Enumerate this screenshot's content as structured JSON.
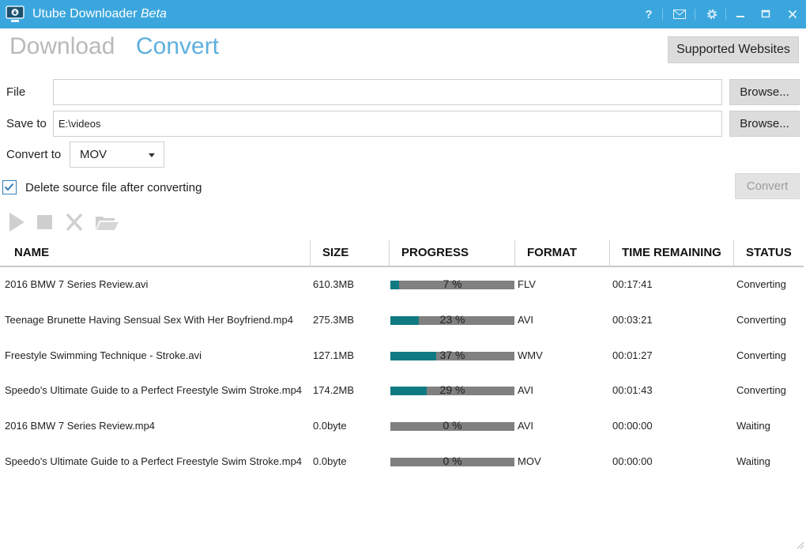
{
  "app": {
    "title": "Utube Downloader",
    "beta": "Beta"
  },
  "tabs": {
    "download": "Download",
    "convert": "Convert"
  },
  "header": {
    "supported_websites": "Supported Websites"
  },
  "form": {
    "file_label": "File",
    "file_value": "",
    "save_to_label": "Save to",
    "save_to_value": "E:\\videos",
    "browse_label": "Browse...",
    "convert_to_label": "Convert to",
    "convert_to_value": "MOV",
    "delete_source_label": "Delete source file after converting",
    "delete_source_checked": true,
    "convert_button": "Convert"
  },
  "toolbar": {
    "icons": [
      "play-icon",
      "stop-icon",
      "delete-icon",
      "open-folder-icon"
    ]
  },
  "table": {
    "headers": [
      "NAME",
      "SIZE",
      "PROGRESS",
      "FORMAT",
      "TIME REMAINING",
      "STATUS"
    ],
    "rows": [
      {
        "name": "2016 BMW 7 Series Review.avi",
        "size": "610.3MB",
        "progress": 7,
        "progress_text": "7 %",
        "format": "FLV",
        "time": "00:17:41",
        "status": "Converting"
      },
      {
        "name": "Teenage Brunette Having Sensual Sex With Her Boyfriend.mp4",
        "size": "275.3MB",
        "progress": 23,
        "progress_text": "23 %",
        "format": "AVI",
        "time": "00:03:21",
        "status": "Converting"
      },
      {
        "name": "Freestyle Swimming Technique - Stroke.avi",
        "size": "127.1MB",
        "progress": 37,
        "progress_text": "37 %",
        "format": "WMV",
        "time": "00:01:27",
        "status": "Converting"
      },
      {
        "name": "Speedo's Ultimate Guide to a Perfect Freestyle Swim Stroke.mp4",
        "size": "174.2MB",
        "progress": 29,
        "progress_text": "29 %",
        "format": "AVI",
        "time": "00:01:43",
        "status": "Converting"
      },
      {
        "name": "2016 BMW 7 Series Review.mp4",
        "size": "0.0byte",
        "progress": 0,
        "progress_text": "0 %",
        "format": "AVI",
        "time": "00:00:00",
        "status": "Waiting"
      },
      {
        "name": "Speedo's Ultimate Guide to a Perfect Freestyle Swim Stroke.mp4",
        "size": "0.0byte",
        "progress": 0,
        "progress_text": "0 %",
        "format": "MOV",
        "time": "00:00:00",
        "status": "Waiting"
      }
    ]
  },
  "colors": {
    "titlebar": "#3aa6dd",
    "accent_tab": "#5db0de",
    "progress_fill": "#107a82",
    "progress_track": "#808080"
  }
}
